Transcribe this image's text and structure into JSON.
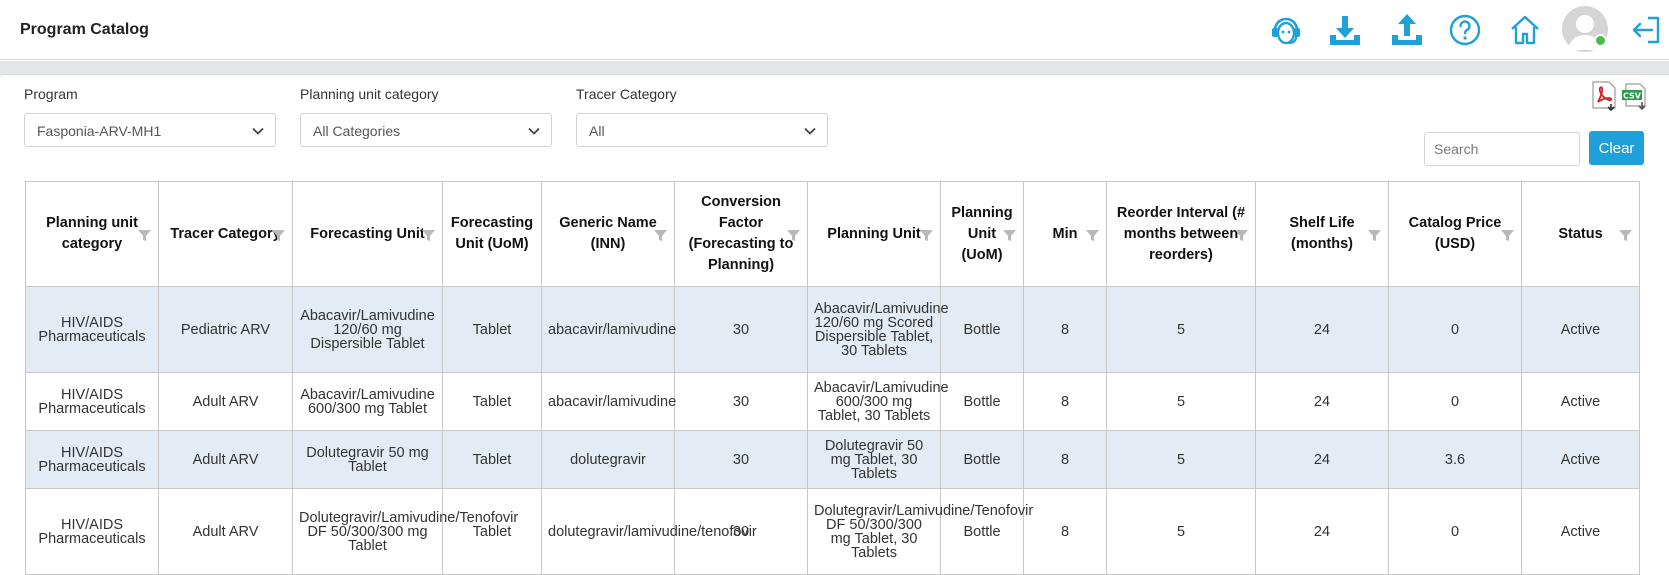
{
  "header": {
    "title": "Program Catalog",
    "icons": [
      "support-agent-icon",
      "download-icon",
      "upload-icon",
      "help-icon",
      "home-icon",
      "user-avatar",
      "logout-icon"
    ]
  },
  "filters": {
    "program": {
      "label": "Program",
      "value": "Fasponia-ARV-MH1"
    },
    "planning_unit_category": {
      "label": "Planning unit category",
      "value": "All Categories"
    },
    "tracer_category": {
      "label": "Tracer Category",
      "value": "All"
    }
  },
  "search": {
    "placeholder": "Search"
  },
  "clear_label": "Clear",
  "export_icons": [
    "pdf-export-icon",
    "csv-export-icon"
  ],
  "colors": {
    "accent": "#1fa0d8",
    "row_shade": "#e3ecf5",
    "online": "#4cbb4a"
  },
  "table": {
    "headers": [
      "Planning unit category",
      "Tracer Category",
      "Forecasting Unit",
      "Forecasting Unit (UoM)",
      "Generic Name (INN)",
      "Conversion Factor (Forecasting to Planning)",
      "Planning Unit",
      "Planning Unit (UoM)",
      "Min",
      "Reorder Interval (# months between reorders)",
      "Shelf Life (months)",
      "Catalog Price (USD)",
      "Status"
    ],
    "rows": [
      [
        "HIV/AIDS Pharmaceuticals",
        "Pediatric ARV",
        "Abacavir/Lamivudine 120/60 mg Dispersible Tablet",
        "Tablet",
        "abacavir/lamivudine",
        "30",
        "Abacavir/Lamivudine 120/60 mg Scored Dispersible Tablet, 30 Tablets",
        "Bottle",
        "8",
        "5",
        "24",
        "0",
        "Active"
      ],
      [
        "HIV/AIDS Pharmaceuticals",
        "Adult ARV",
        "Abacavir/Lamivudine 600/300 mg Tablet",
        "Tablet",
        "abacavir/lamivudine",
        "30",
        "Abacavir/Lamivudine 600/300 mg Tablet, 30 Tablets",
        "Bottle",
        "8",
        "5",
        "24",
        "0",
        "Active"
      ],
      [
        "HIV/AIDS Pharmaceuticals",
        "Adult ARV",
        "Dolutegravir 50 mg Tablet",
        "Tablet",
        "dolutegravir",
        "30",
        "Dolutegravir 50 mg Tablet, 30 Tablets",
        "Bottle",
        "8",
        "5",
        "24",
        "3.6",
        "Active"
      ],
      [
        "HIV/AIDS Pharmaceuticals",
        "Adult ARV",
        "Dolutegravir/Lamivudine/Tenofovir DF 50/300/300 mg Tablet",
        "Tablet",
        "dolutegravir/lamivudine/tenofovir",
        "30",
        "Dolutegravir/Lamivudine/Tenofovir DF 50/300/300 mg Tablet, 30 Tablets",
        "Bottle",
        "8",
        "5",
        "24",
        "0",
        "Active"
      ]
    ]
  }
}
